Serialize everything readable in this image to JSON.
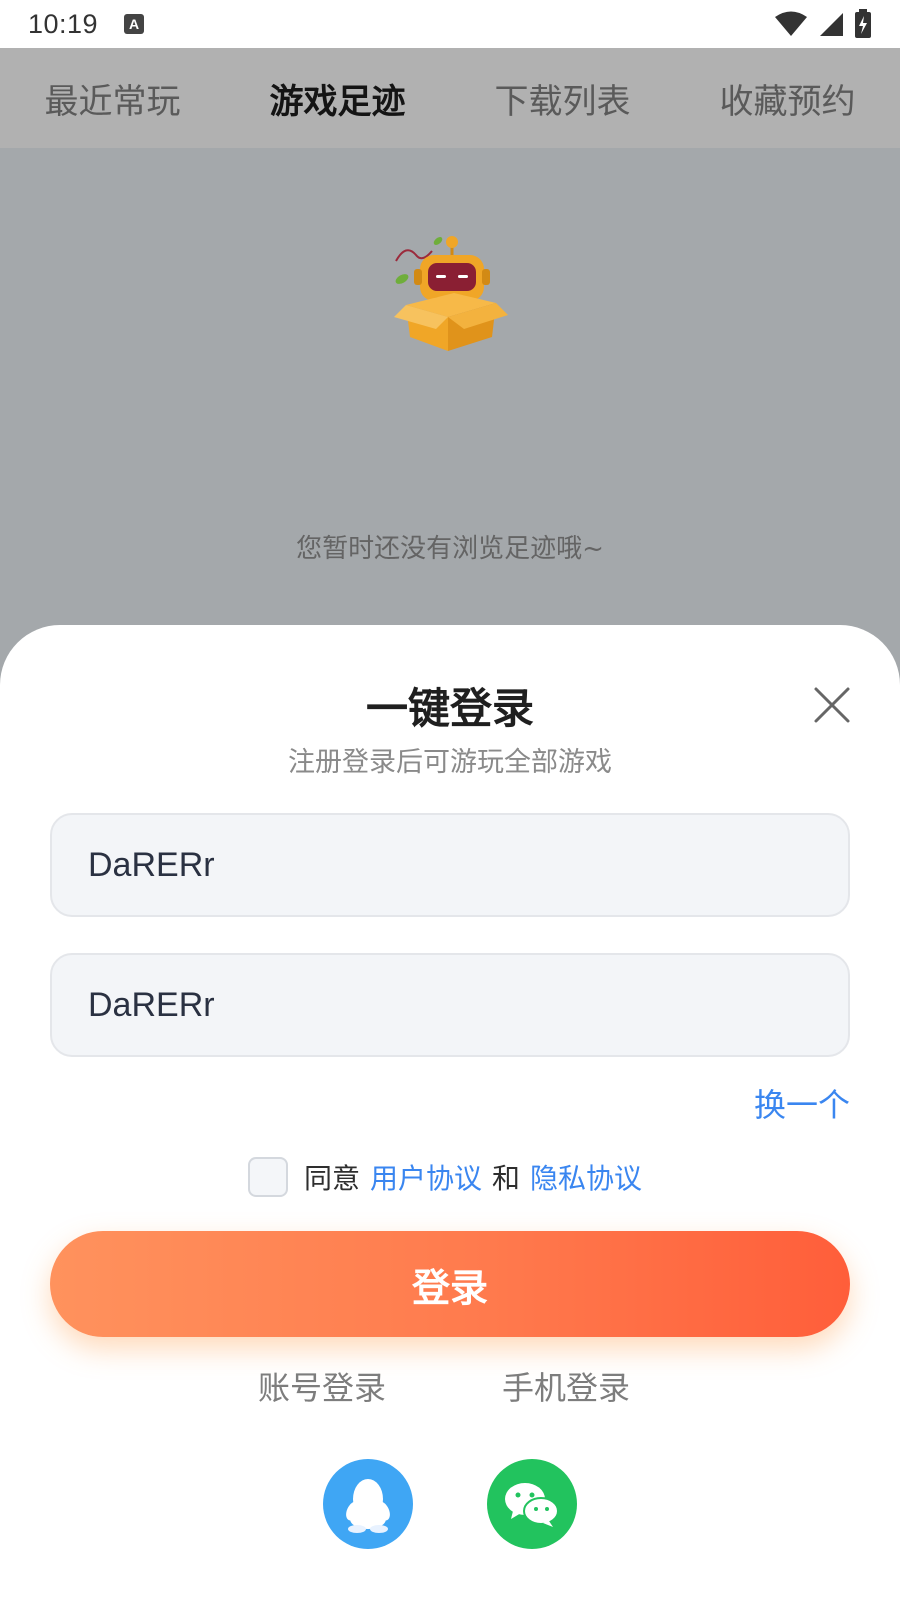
{
  "status_bar": {
    "time": "10:19",
    "notification_icon_letter": "A"
  },
  "tabs": [
    {
      "label": "最近常玩",
      "active": false
    },
    {
      "label": "游戏足迹",
      "active": true
    },
    {
      "label": "下载列表",
      "active": false
    },
    {
      "label": "收藏预约",
      "active": false
    }
  ],
  "empty_state": {
    "illustration": "robot-in-box-icon",
    "message": "您暂时还没有浏览足迹哦~"
  },
  "login_sheet": {
    "title": "一键登录",
    "subtitle": "注册登录后可游玩全部游戏",
    "username_value": "DaRERr",
    "password_value": "DaRERr",
    "swap_label": "换一个",
    "agree": {
      "prefix": "同意",
      "user_agreement": "用户协议",
      "and": "和",
      "privacy_policy": "隐私协议",
      "checked": false
    },
    "login_button": "登录",
    "account_login": "账号登录",
    "phone_login": "手机登录",
    "social": [
      {
        "name": "qq-icon",
        "color": "#3fa6f4"
      },
      {
        "name": "wechat-icon",
        "color": "#22c35e"
      }
    ]
  },
  "colors": {
    "accent_blue": "#3a86f0",
    "login_gradient_start": "#ff925d",
    "login_gradient_end": "#ff5e3a",
    "overlay": "#a4a8ab"
  }
}
